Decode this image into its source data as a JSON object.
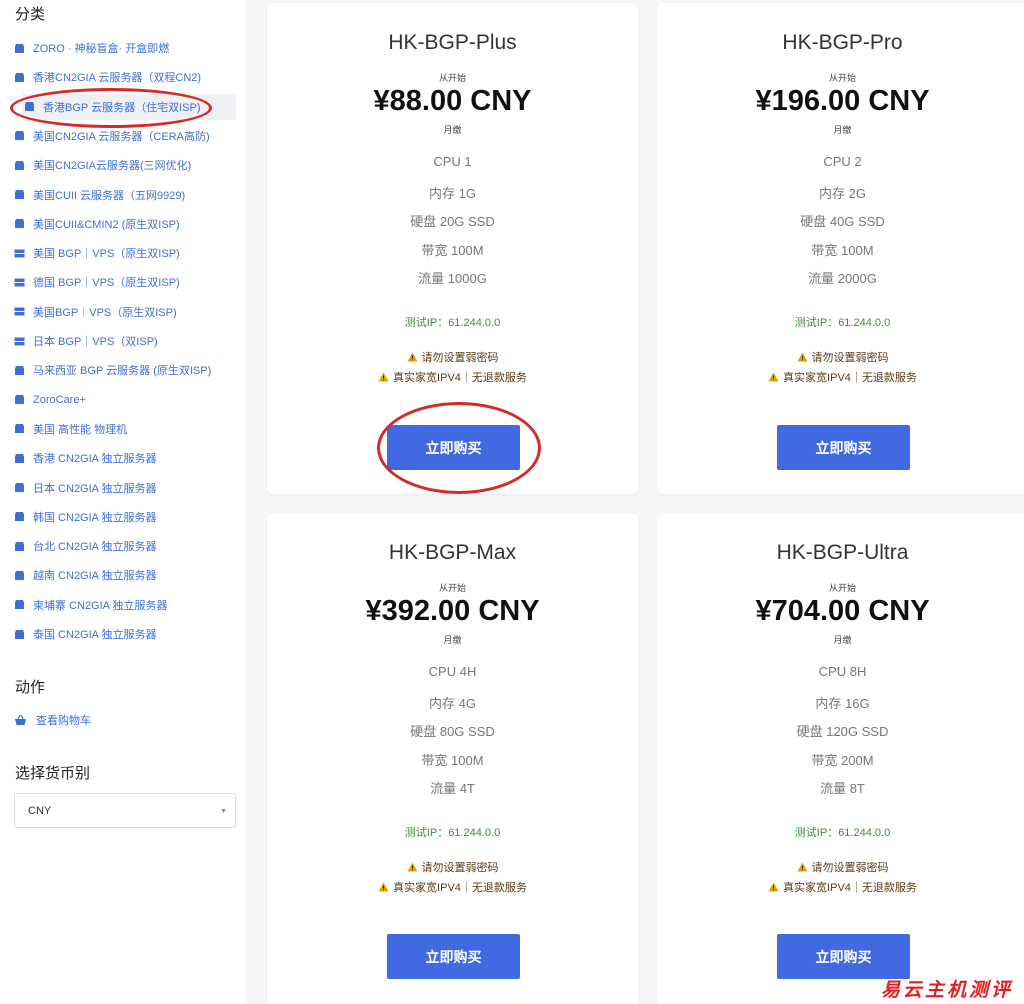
{
  "sidebar": {
    "categories_title": "分类",
    "categories": [
      {
        "label": "ZORO · 神秘盲盒· 开盒即燃",
        "icon": "box-icon"
      },
      {
        "label": "香港CN2GIA 云服务器（双程CN2)",
        "icon": "box-icon"
      },
      {
        "label": "香港BGP 云服务器（住宅双ISP)",
        "icon": "box-icon",
        "active": true
      },
      {
        "label": "美国CN2GIA 云服务器（CERA高防)",
        "icon": "box-icon"
      },
      {
        "label": "美国CN2GIA云服务器(三网优化)",
        "icon": "box-icon"
      },
      {
        "label": "美国CUII 云服务器（五网9929)",
        "icon": "box-icon"
      },
      {
        "label": "美国CUII&CMIN2 (原生双ISP)",
        "icon": "box-icon"
      },
      {
        "label": "美国 BGP｜VPS（原生双ISP)",
        "icon": "server-icon"
      },
      {
        "label": "德国 BGP｜VPS（原生双ISP)",
        "icon": "server-icon"
      },
      {
        "label": "美国BGP｜VPS（原生双ISP)",
        "icon": "server-icon"
      },
      {
        "label": "日本 BGP｜VPS（双ISP)",
        "icon": "server-icon"
      },
      {
        "label": "马来西亚 BGP 云服务器 (原生双ISP)",
        "icon": "box-icon"
      },
      {
        "label": "ZoroCare+",
        "icon": "box-icon"
      },
      {
        "label": "美国 高性能 物理机",
        "icon": "box-icon"
      },
      {
        "label": "香港 CN2GIA 独立服务器",
        "icon": "box-icon"
      },
      {
        "label": "日本 CN2GIA 独立服务器",
        "icon": "box-icon"
      },
      {
        "label": "韩国 CN2GIA 独立服务器",
        "icon": "box-icon"
      },
      {
        "label": "台北 CN2GIA 独立服务器",
        "icon": "box-icon"
      },
      {
        "label": "越南 CN2GIA 独立服务器",
        "icon": "box-icon"
      },
      {
        "label": "柬埔寨 CN2GIA 独立服务器",
        "icon": "box-icon"
      },
      {
        "label": "泰国 CN2GIA 独立服务器",
        "icon": "box-icon"
      }
    ],
    "actions_title": "动作",
    "view_cart_label": "查看购物车",
    "currency_title": "选择货币别",
    "currency_value": "CNY"
  },
  "products": [
    {
      "name": "HK-BGP-Plus",
      "from_label": "从开始",
      "price": "¥88.00 CNY",
      "cycle": "月缴",
      "specs": [
        "CPU 1",
        "内存 1G",
        "硬盘 20G SSD",
        "带宽 100M",
        "流量 1000G"
      ],
      "test_ip": "测试IP：61.244.0.0",
      "warnings": [
        "请勿设置弱密码",
        "真实家宽IPV4｜无退款服务"
      ],
      "buy_label": "立即购买"
    },
    {
      "name": "HK-BGP-Pro",
      "from_label": "从开始",
      "price": "¥196.00 CNY",
      "cycle": "月缴",
      "specs": [
        "CPU 2",
        "内存 2G",
        "硬盘 40G SSD",
        "带宽 100M",
        "流量 2000G"
      ],
      "test_ip": "测试IP：61.244.0.0",
      "warnings": [
        "请勿设置弱密码",
        "真实家宽IPV4｜无退款服务"
      ],
      "buy_label": "立即购买"
    },
    {
      "name": "HK-BGP-Max",
      "from_label": "从开始",
      "price": "¥392.00 CNY",
      "cycle": "月缴",
      "specs": [
        "CPU 4H",
        "内存 4G",
        "硬盘 80G SSD",
        "带宽 100M",
        "流量 4T"
      ],
      "test_ip": "测试IP：61.244.0.0",
      "warnings": [
        "请勿设置弱密码",
        "真实家宽IPV4｜无退款服务"
      ],
      "buy_label": "立即购买"
    },
    {
      "name": "HK-BGP-Ultra",
      "from_label": "从开始",
      "price": "¥704.00 CNY",
      "cycle": "月缴",
      "specs": [
        "CPU 8H",
        "内存 16G",
        "硬盘 120G SSD",
        "带宽 200M",
        "流量 8T"
      ],
      "test_ip": "测试IP：61.244.0.0",
      "warnings": [
        "请勿设置弱密码",
        "真实家宽IPV4｜无退款服务"
      ],
      "buy_label": "立即购买"
    }
  ],
  "watermark": "易云主机测评",
  "colors": {
    "accent": "#4169e1",
    "link": "#3f6fd4",
    "test_ip": "#3c8d3c",
    "annotation": "#d42a2a",
    "warning": "#e0a000"
  }
}
